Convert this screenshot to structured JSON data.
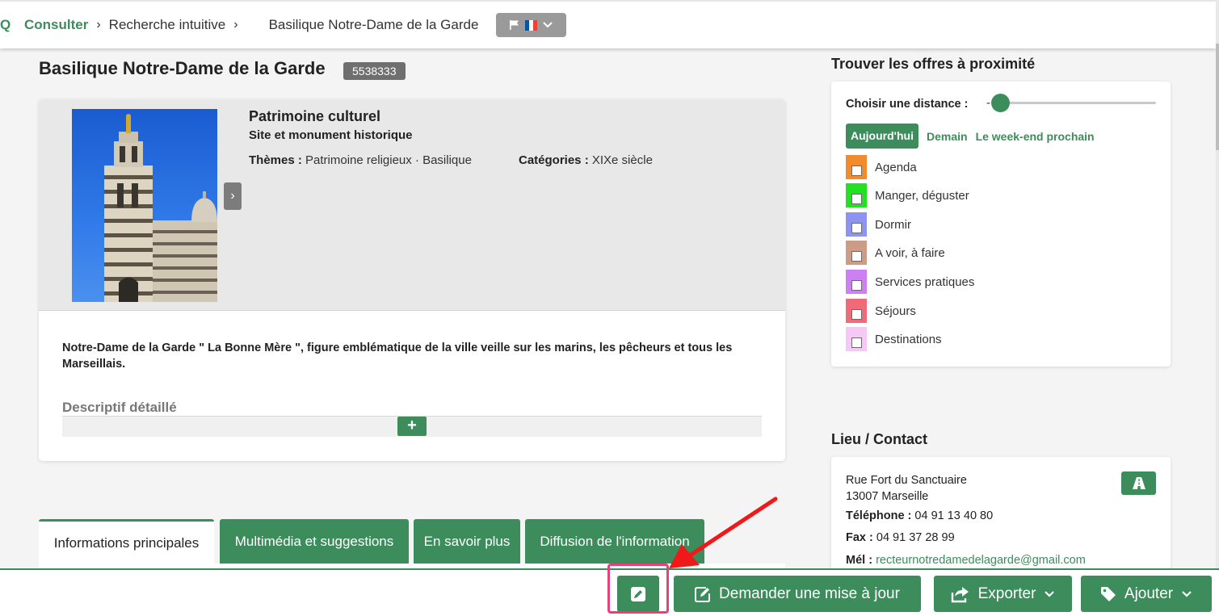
{
  "breadcrumb": {
    "search_glyph": "Q",
    "consulter": "Consulter",
    "sep": "›",
    "recherche": "Recherche intuitive",
    "current": "Basilique Notre-Dame de la Garde"
  },
  "language": {
    "flag_colors": [
      "#0055a4",
      "#ffffff",
      "#ef4135"
    ]
  },
  "offer": {
    "title": "Basilique Notre-Dame de la Garde",
    "id": "5538333",
    "category": "Patrimoine culturel",
    "subcategory": "Site et monument historique",
    "themes_label": "Thèmes :",
    "themes_value": "Patrimoine religieux · Basilique",
    "categories_label": "Catégories :",
    "categories_value": "XIXe siècle",
    "description": "Notre-Dame de la Garde \" La Bonne Mère \", figure emblématique de la ville veille sur les marins, les pêcheurs et tous les Marseillais.",
    "detailed_title": "Descriptif détaillé",
    "plus_label": "+",
    "next_label": "›"
  },
  "tabs": [
    {
      "label": "Informations principales",
      "active": true
    },
    {
      "label": "Multimédia et suggestions",
      "active": false
    },
    {
      "label": "En savoir plus",
      "active": false
    },
    {
      "label": "Diffusion de l'information",
      "active": false
    }
  ],
  "proximity": {
    "title": "Trouver les offres à proximité",
    "distance_label": "Choisir une distance :",
    "distance_dash": "-",
    "dates": [
      "Aujourd'hui",
      "Demain",
      "Le week-end prochain"
    ],
    "filters": [
      {
        "label": "Agenda",
        "color": "#f28a2e"
      },
      {
        "label": "Manger, déguster",
        "color": "#22e022"
      },
      {
        "label": "Dormir",
        "color": "#8d93f0"
      },
      {
        "label": "A voir, à faire",
        "color": "#cc9c86"
      },
      {
        "label": "Services pratiques",
        "color": "#cd80f2"
      },
      {
        "label": "Séjours",
        "color": "#f06a78"
      },
      {
        "label": "Destinations",
        "color": "#f6c8f6"
      }
    ]
  },
  "contact": {
    "title": "Lieu / Contact",
    "address_line1": "Rue Fort du Sanctuaire",
    "address_line2": "13007 Marseille",
    "phone_label": "Téléphone :",
    "phone": "04 91 13 40 80",
    "fax_label": "Fax :",
    "fax": "04 91 37 28 99",
    "mail_label": "Mél :",
    "mail": "recteurnotredamedelagarde@gmail.com"
  },
  "actions": {
    "request_update": "Demander une mise à jour",
    "export": "Exporter",
    "add": "Ajouter"
  },
  "colors": {
    "accent": "#3c8c5c",
    "annotation": "#e8417a"
  }
}
